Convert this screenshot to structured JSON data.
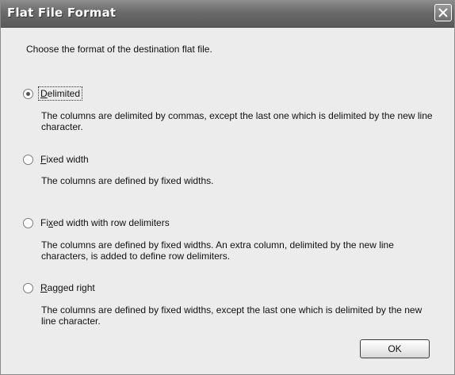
{
  "window": {
    "title": "Flat File Format"
  },
  "dialog": {
    "instruction": "Choose the format of the destination flat file.",
    "options": [
      {
        "label_underlined": "D",
        "label_rest": "elimited",
        "selected": true,
        "description": "The columns are delimited by commas, except the last one which is delimited by the new line character."
      },
      {
        "label_underlined": "F",
        "label_rest": "ixed width",
        "selected": false,
        "description": "The columns are defined by fixed widths."
      },
      {
        "label_before": "Fi",
        "label_underlined": "x",
        "label_rest": "ed width with row delimiters",
        "selected": false,
        "description": "The columns are defined by fixed widths. An extra column, delimited by the new line characters, is added to define row delimiters."
      },
      {
        "label_underlined": "R",
        "label_rest": "agged right",
        "selected": false,
        "description": "The columns are defined by fixed widths, except the last one which is delimited by the new line character."
      }
    ],
    "ok_label": "OK"
  }
}
